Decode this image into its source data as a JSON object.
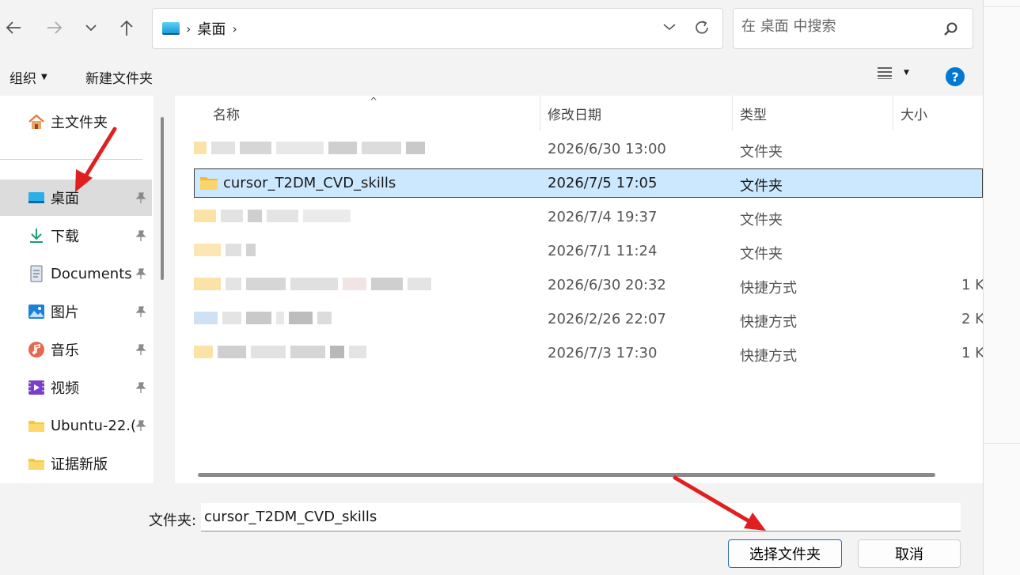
{
  "navigation": {
    "back": "back-arrow",
    "forward": "forward-arrow",
    "recent": "chevron-down",
    "up": "up-arrow"
  },
  "address_bar": {
    "crumb": "桌面"
  },
  "search": {
    "placeholder": "在 桌面 中搜索"
  },
  "toolbar": {
    "organize_label": "组织",
    "new_folder_label": "新建文件夹"
  },
  "sidebar": {
    "home_label": "主文件夹",
    "items": [
      {
        "label": "桌面",
        "icon": "desktop-icon",
        "pinned": true,
        "selected": true
      },
      {
        "label": "下载",
        "icon": "download-icon",
        "pinned": true
      },
      {
        "label": "Documents",
        "icon": "document-icon",
        "pinned": true
      },
      {
        "label": "图片",
        "icon": "pictures-icon",
        "pinned": true
      },
      {
        "label": "音乐",
        "icon": "music-icon",
        "pinned": true
      },
      {
        "label": "视频",
        "icon": "video-icon",
        "pinned": true
      },
      {
        "label": "Ubuntu-22.(",
        "icon": "folder-icon",
        "pinned": true
      },
      {
        "label": "证据新版",
        "icon": "folder-icon",
        "pinned": false
      }
    ]
  },
  "file_list": {
    "columns": [
      "名称",
      "修改日期",
      "类型",
      "大小"
    ],
    "rows": [
      {
        "name": "",
        "date": "2026/6/30 13:00",
        "type": "文件夹",
        "size": "",
        "blurred": true
      },
      {
        "name": "cursor_T2DM_CVD_skills",
        "date": "2026/7/5 17:05",
        "type": "文件夹",
        "size": "",
        "selected": true
      },
      {
        "name": "",
        "date": "2026/7/4 19:37",
        "type": "文件夹",
        "size": "",
        "blurred": true
      },
      {
        "name": "",
        "date": "2026/7/1 11:24",
        "type": "文件夹",
        "size": "",
        "blurred": true
      },
      {
        "name": "",
        "date": "2026/6/30 20:32",
        "type": "快捷方式",
        "size": "1 K",
        "blurred": true
      },
      {
        "name": "",
        "date": "2026/2/26 22:07",
        "type": "快捷方式",
        "size": "2 K",
        "blurred": true
      },
      {
        "name": "",
        "date": "2026/7/3 17:30",
        "type": "快捷方式",
        "size": "1 K",
        "blurred": true
      }
    ]
  },
  "footer": {
    "folder_label": "文件夹:",
    "folder_value": "cursor_T2DM_CVD_skills",
    "select_button": "选择文件夹",
    "cancel_button": "取消"
  },
  "colors": {
    "selection": "#cce8ff",
    "accent": "#0078d4",
    "annotation_arrow": "#e02020"
  }
}
